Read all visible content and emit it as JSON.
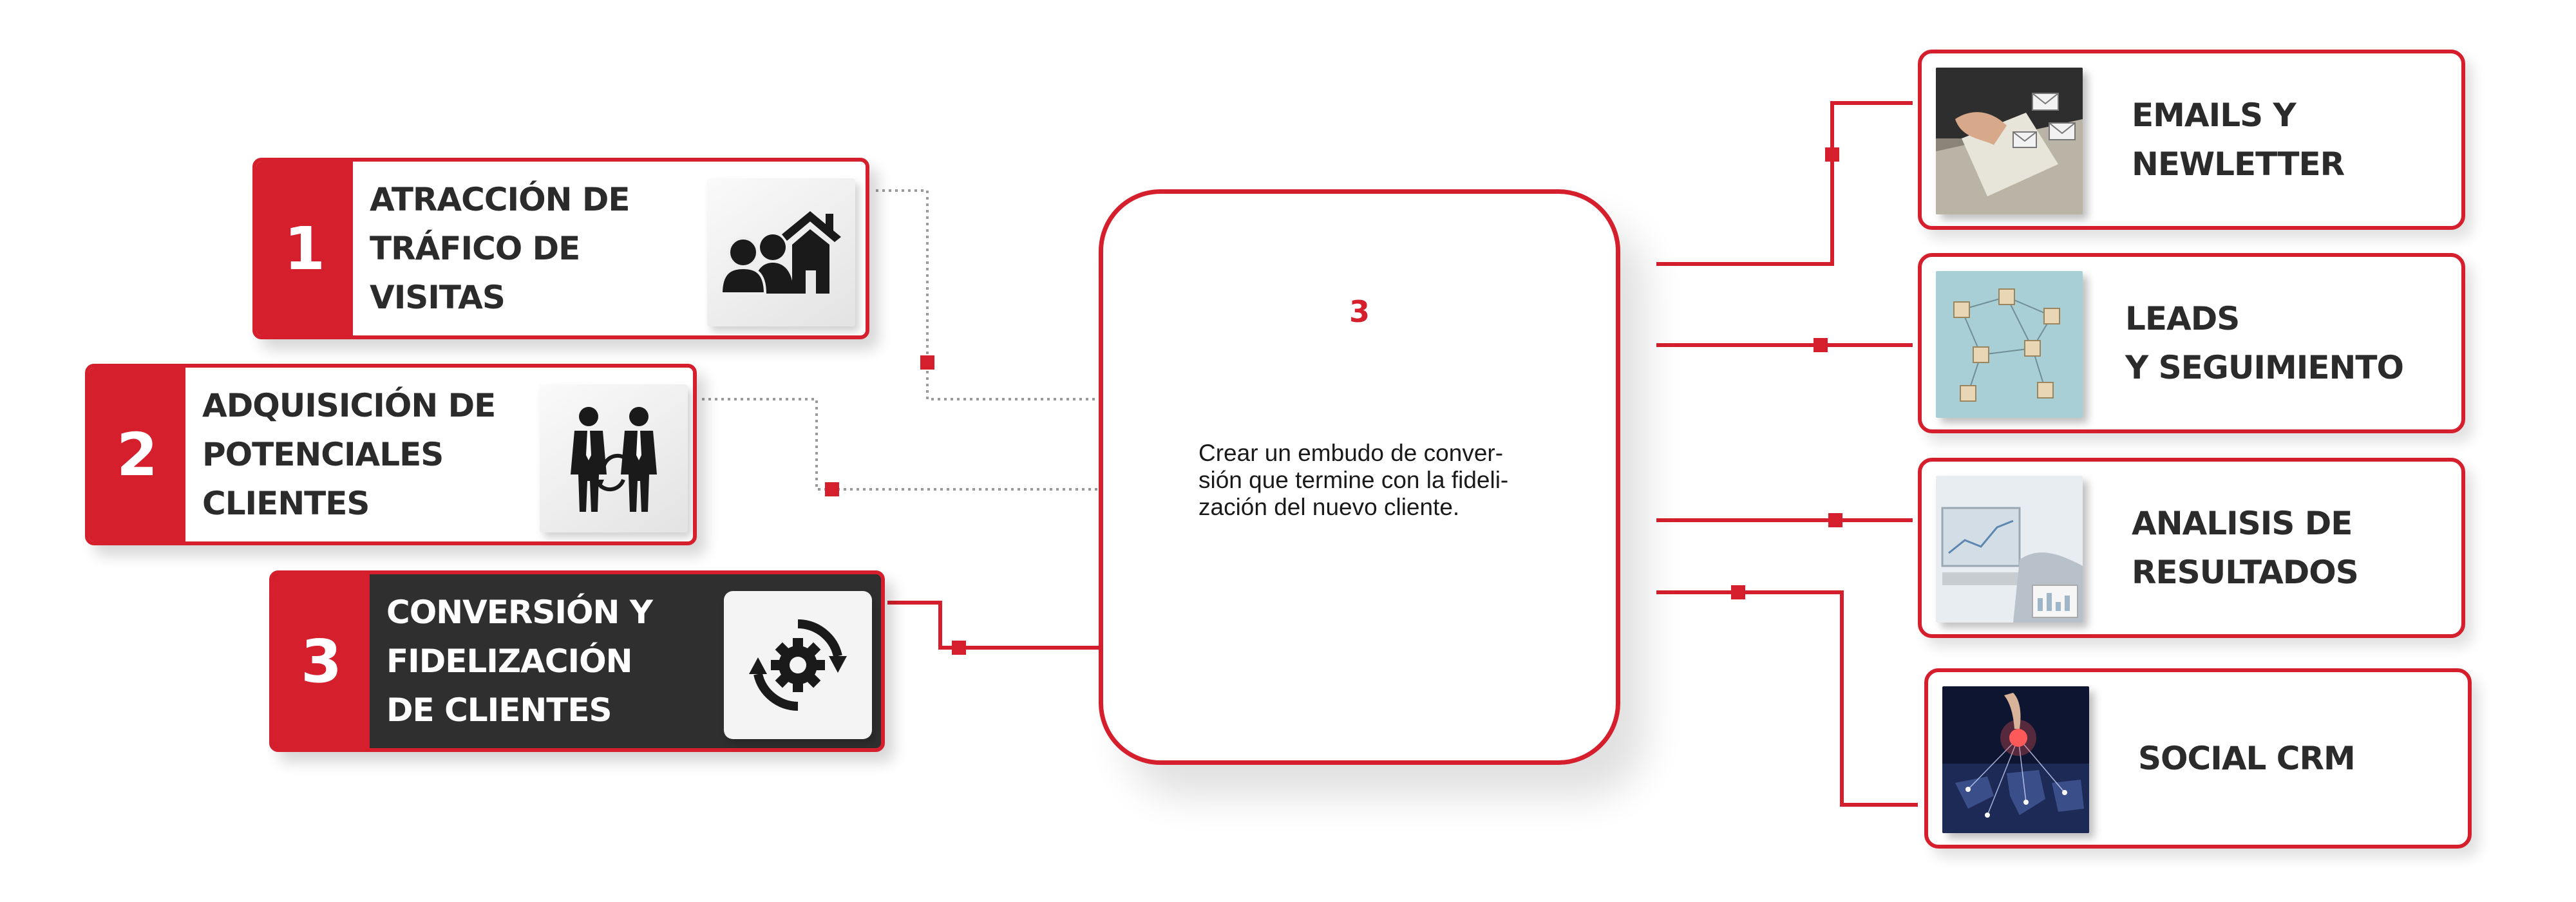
{
  "steps": [
    {
      "number": "1",
      "title": "ATRACCIÓN DE\nTRÁFICO DE VISITAS",
      "icon": "people-house-icon"
    },
    {
      "number": "2",
      "title": "ADQUISICIÓN DE\nPOTENCIALES\nCLIENTES",
      "icon": "businessmen-exchange-icon"
    },
    {
      "number": "3",
      "title": "CONVERSIÓN Y\nFIDELIZACIÓN\nDE CLIENTES",
      "icon": "gear-cycle-icon"
    }
  ],
  "center": {
    "number": "3",
    "text": "Crear un embudo de conver-\nsión que termine con la fideli-\nzación del nuevo cliente."
  },
  "outcomes": [
    {
      "title": "EMAILS Y\nNEWLETTER",
      "image": "emails-photo"
    },
    {
      "title": "LEADS\nY SEGUIMIENTO",
      "image": "leads-network-photo"
    },
    {
      "title": "ANALISIS DE\nRESULTADOS",
      "image": "analytics-photo"
    },
    {
      "title": "SOCIAL CRM",
      "image": "social-globe-photo"
    }
  ],
  "colors": {
    "accent": "#d51f2d",
    "dark": "#2f2f2f",
    "text": "#2b2b2b",
    "connector_dotted": "#9a9a9a"
  }
}
